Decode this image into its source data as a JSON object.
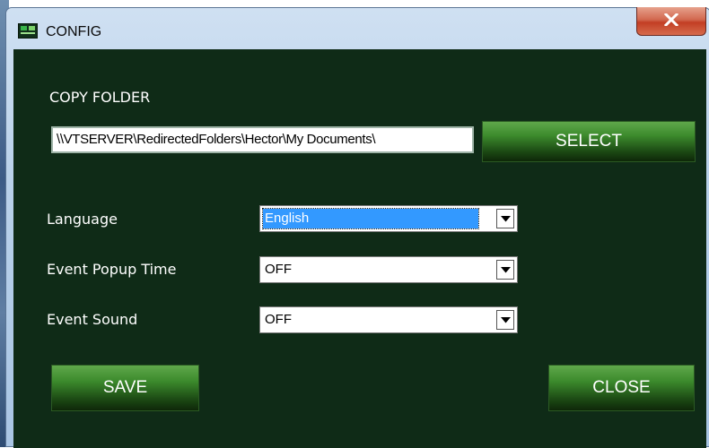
{
  "window": {
    "title": "CONFIG"
  },
  "copy_folder": {
    "label": "COPY FOLDER",
    "path": "\\\\VTSERVER\\RedirectedFolders\\Hector\\My Documents\\",
    "select_label": "SELECT"
  },
  "settings": {
    "language": {
      "label": "Language",
      "value": "English"
    },
    "popup_time": {
      "label": "Event Popup Time",
      "value": "OFF"
    },
    "sound": {
      "label": "Event Sound",
      "value": "OFF"
    }
  },
  "buttons": {
    "save": "SAVE",
    "close": "CLOSE"
  },
  "icons": {
    "app": "app-icon",
    "close": "close-icon",
    "dropdown": "chevron-down-icon"
  },
  "colors": {
    "background": "#0f2b17",
    "button_green": "#3c8a2c",
    "selection": "#3399ff",
    "titlebar": "#b9d1ea",
    "close_red": "#c23e24"
  }
}
